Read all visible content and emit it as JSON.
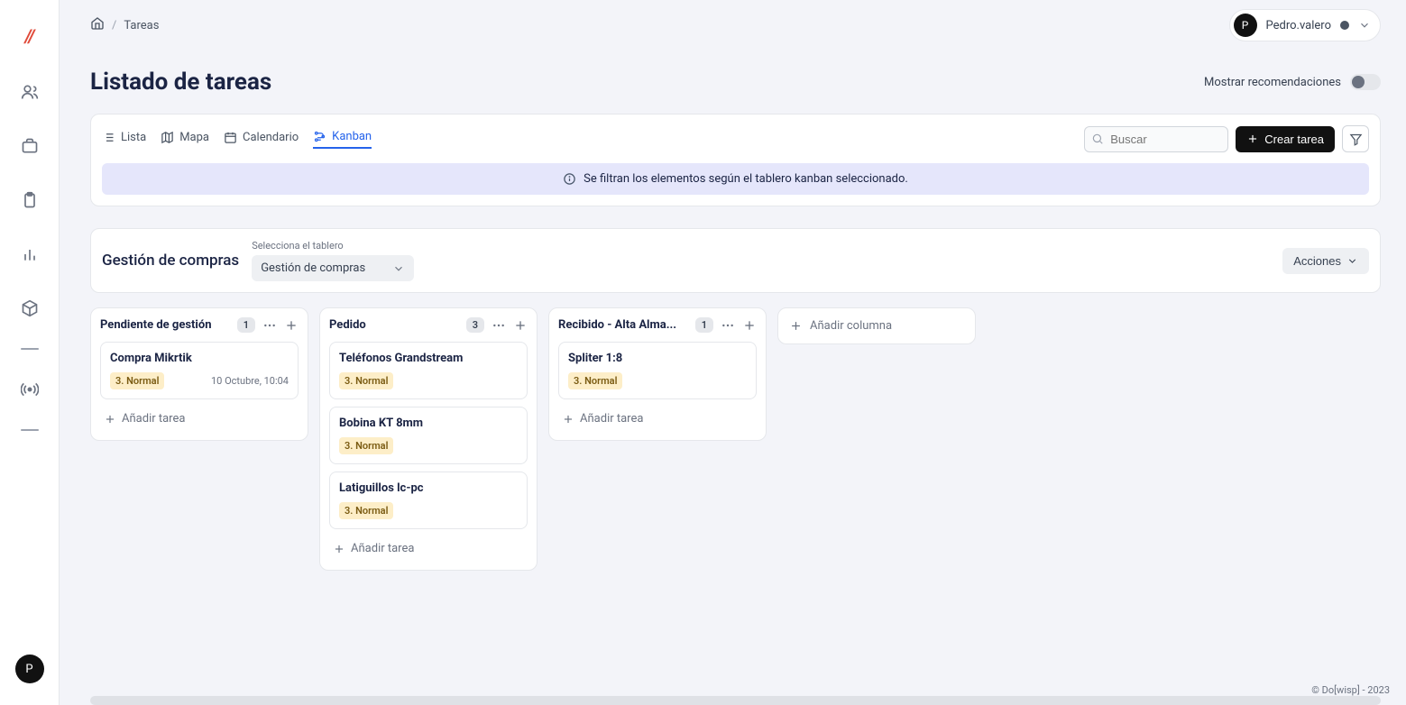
{
  "breadcrumb": {
    "item": "Tareas",
    "sep": "/"
  },
  "user": {
    "name": "Pedro.valero",
    "initial": "P"
  },
  "title": "Listado de tareas",
  "recommendations_label": "Mostrar recomendaciones",
  "view_tabs": {
    "list": "Lista",
    "map": "Mapa",
    "calendar": "Calendario",
    "kanban": "Kanban"
  },
  "search_placeholder": "Buscar",
  "create_task": "Crear tarea",
  "alert": "Se filtran los elementos según el tablero kanban seleccionado.",
  "board_title": "Gestión de compras",
  "select_label": "Selecciona el tablero",
  "select_value": "Gestión de compras",
  "actions_label": "Acciones",
  "add_task_label": "Añadir tarea",
  "add_column_label": "Añadir columna",
  "columns": [
    {
      "title": "Pendiente de gestión",
      "count": "1",
      "cards": [
        {
          "title": "Compra Mikrtik",
          "tag": "3. Normal",
          "date": "10 Octubre, 10:04"
        }
      ]
    },
    {
      "title": "Pedido",
      "count": "3",
      "cards": [
        {
          "title": "Teléfonos Grandstream",
          "tag": "3. Normal",
          "date": ""
        },
        {
          "title": "Bobina KT 8mm",
          "tag": "3. Normal",
          "date": ""
        },
        {
          "title": "Latiguillos lc-pc",
          "tag": "3. Normal",
          "date": ""
        }
      ]
    },
    {
      "title": "Recibido - Alta Alma...",
      "count": "1",
      "cards": [
        {
          "title": "Spliter 1:8",
          "tag": "3. Normal",
          "date": ""
        }
      ]
    }
  ],
  "footer": "© Do[wisp] - 2023",
  "sidebar_avatar_initial": "P"
}
